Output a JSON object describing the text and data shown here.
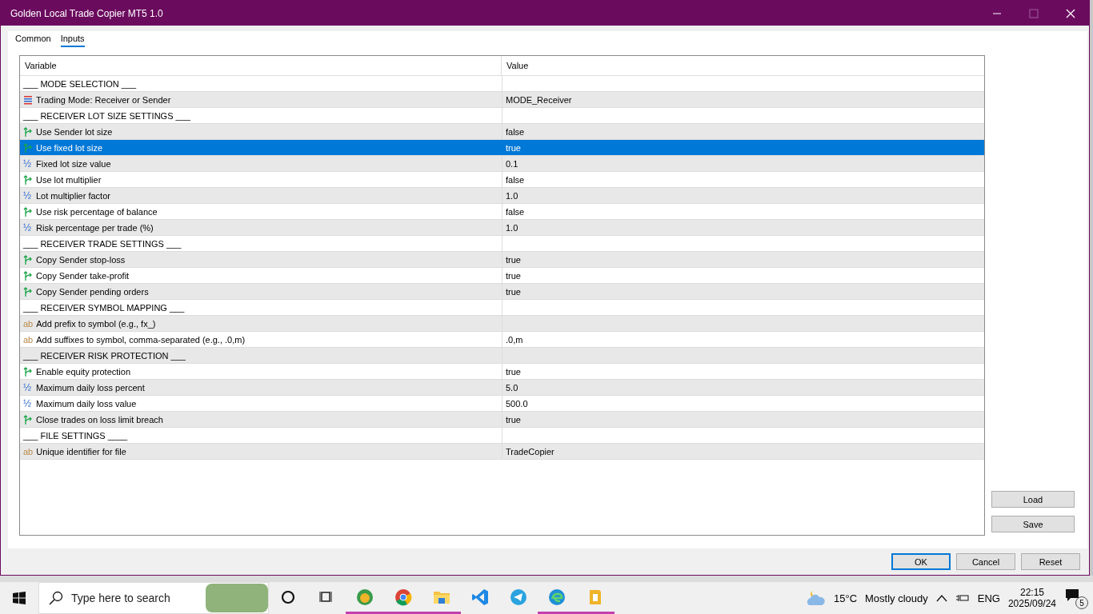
{
  "window": {
    "title": "Golden Local Trade Copier MT5 1.0"
  },
  "tabs": [
    {
      "label": "Common",
      "selected": false
    },
    {
      "label": "Inputs",
      "selected": true
    }
  ],
  "table": {
    "columns": [
      "Variable",
      "Value"
    ],
    "rows": [
      {
        "kind": "section",
        "variable": "___ MODE SELECTION ___",
        "value": "",
        "selected": false
      },
      {
        "kind": "enum",
        "variable": "Trading Mode: Receiver or Sender",
        "value": "MODE_Receiver",
        "selected": false
      },
      {
        "kind": "section",
        "variable": "___ RECEIVER LOT SIZE SETTINGS ___",
        "value": "",
        "selected": false
      },
      {
        "kind": "bool",
        "variable": "Use Sender lot size",
        "value": "false",
        "selected": false
      },
      {
        "kind": "bool",
        "variable": "Use fixed lot size",
        "value": "true",
        "selected": true
      },
      {
        "kind": "double",
        "icon": "½",
        "variable": "Fixed lot size value",
        "value": "0.1",
        "selected": false
      },
      {
        "kind": "bool",
        "variable": "Use lot multiplier",
        "value": "false",
        "selected": false
      },
      {
        "kind": "double",
        "icon": "½",
        "variable": "Lot multiplier factor",
        "value": "1.0",
        "selected": false
      },
      {
        "kind": "bool",
        "variable": "Use risk percentage of balance",
        "value": "false",
        "selected": false
      },
      {
        "kind": "double",
        "icon": "½",
        "variable": "Risk percentage per trade (%)",
        "value": "1.0",
        "selected": false
      },
      {
        "kind": "section",
        "variable": "___ RECEIVER TRADE SETTINGS ___",
        "value": "",
        "selected": false
      },
      {
        "kind": "bool",
        "variable": "Copy Sender stop-loss",
        "value": "true",
        "selected": false
      },
      {
        "kind": "bool",
        "variable": "Copy Sender take-profit",
        "value": "true",
        "selected": false
      },
      {
        "kind": "bool",
        "variable": "Copy Sender pending orders",
        "value": "true",
        "selected": false
      },
      {
        "kind": "section",
        "variable": "___ RECEIVER SYMBOL MAPPING ___",
        "value": "",
        "selected": false
      },
      {
        "kind": "string",
        "icon": "ab",
        "variable": "Add prefix to symbol (e.g., fx_)",
        "value": "",
        "selected": false
      },
      {
        "kind": "string",
        "icon": "ab",
        "variable": "Add suffixes to symbol, comma-separated (e.g., .0,m)",
        "value": ".0,m",
        "selected": false
      },
      {
        "kind": "section",
        "variable": "___ RECEIVER RISK PROTECTION ___",
        "value": "",
        "selected": false
      },
      {
        "kind": "bool",
        "variable": "Enable equity protection",
        "value": "true",
        "selected": false
      },
      {
        "kind": "double",
        "icon": "½",
        "variable": "Maximum daily loss percent",
        "value": "5.0",
        "selected": false
      },
      {
        "kind": "double",
        "icon": "½",
        "variable": "Maximum daily loss value",
        "value": "500.0",
        "selected": false
      },
      {
        "kind": "bool",
        "variable": "Close trades on loss limit breach",
        "value": "true",
        "selected": false
      },
      {
        "kind": "section",
        "variable": "___ FILE SETTINGS ____",
        "value": "",
        "selected": false
      },
      {
        "kind": "string",
        "icon": "ab",
        "variable": "Unique identifier for file",
        "value": "TradeCopier",
        "selected": false
      }
    ]
  },
  "side_buttons": [
    "Load",
    "Save"
  ],
  "footer_buttons": [
    {
      "label": "OK",
      "default": true
    },
    {
      "label": "Cancel",
      "default": false
    },
    {
      "label": "Reset",
      "default": false
    }
  ],
  "taskbar": {
    "search": {
      "placeholder": "Type here to search"
    },
    "apps": [
      {
        "kind": "metatrader",
        "running": true
      },
      {
        "kind": "chrome",
        "running": true
      },
      {
        "kind": "folder",
        "running": true
      },
      {
        "kind": "vscode",
        "running": false
      },
      {
        "kind": "telegram",
        "running": false
      },
      {
        "kind": "edge",
        "running": true
      },
      {
        "kind": "app5",
        "running": true
      }
    ],
    "weather": {
      "temperature": "15°C",
      "condition": "Mostly cloudy"
    },
    "language": "ENG",
    "time": "22:15",
    "date": "2025/09/24",
    "notifications": "5"
  }
}
